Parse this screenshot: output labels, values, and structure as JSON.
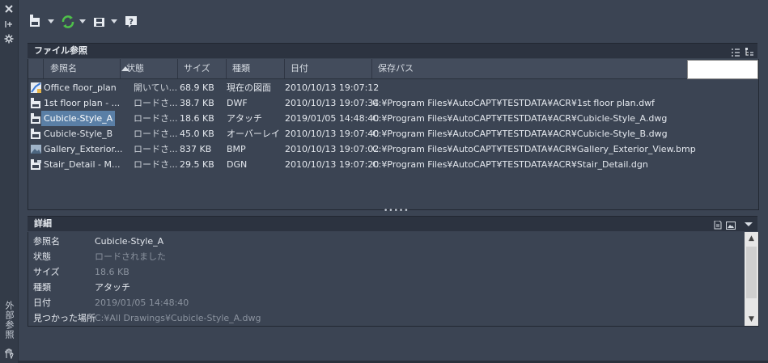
{
  "palette": {
    "window_bg": "#3b4453",
    "header_bg": "#2c3340",
    "selection": "#5a7fa6",
    "refresh_green": "#4fc04a"
  },
  "left_strip": {
    "title": "外部参照",
    "icons": [
      "close-icon",
      "pin-icon",
      "settings-icon",
      "hand-icon"
    ]
  },
  "toolbar": {
    "icons": [
      "attach-dwg-icon",
      "refresh-icon",
      "change-path-icon",
      "help-icon"
    ],
    "help_glyph": "?"
  },
  "file_refs": {
    "title": "ファイル参照",
    "columns": [
      "参照名",
      "状態",
      "サイズ",
      "種類",
      "日付",
      "保存パス"
    ],
    "rows": [
      {
        "name": "Office floor_plan",
        "status": "開いてい...",
        "size": "68.9 KB",
        "type": "現在の図面",
        "date": "2010/10/13 19:07:12",
        "path": "",
        "icon": "dwg-open-icon"
      },
      {
        "name": "1st floor plan - ...",
        "status": "ロードさ...",
        "size": "38.7 KB",
        "type": "DWF",
        "date": "2010/10/13 19:07:34",
        "path": "C:¥Program Files¥AutoCAPT¥TESTDATA¥ACR¥1st floor plan.dwf",
        "icon": "dwf-icon"
      },
      {
        "name": "Cubicle-Style_A",
        "status": "ロードさ...",
        "size": "18.6 KB",
        "type": "アタッチ",
        "date": "2019/01/05 14:48:40",
        "path": "C:¥Program Files¥AutoCAPT¥TESTDATA¥ACR¥Cubicle-Style_A.dwg",
        "icon": "dwg-icon",
        "selected": true
      },
      {
        "name": "Cubicle-Style_B",
        "status": "ロードさ...",
        "size": "45.0 KB",
        "type": "オーバーレイ",
        "date": "2010/10/13 19:07:40",
        "path": "C:¥Program Files¥AutoCAPT¥TESTDATA¥ACR¥Cubicle-Style_B.dwg",
        "icon": "dwg-icon"
      },
      {
        "name": "Gallery_Exterior...",
        "status": "ロードさ...",
        "size": "837 KB",
        "type": "BMP",
        "date": "2010/10/13 19:07:02",
        "path": "C:¥Program Files¥AutoCAPT¥TESTDATA¥ACR¥Gallery_Exterior_View.bmp",
        "icon": "image-icon"
      },
      {
        "name": "Stair_Detail - M...",
        "status": "ロードさ...",
        "size": "29.5 KB",
        "type": "DGN",
        "date": "2010/10/13 19:07:20",
        "path": "C:¥Program Files¥AutoCAPT¥TESTDATA¥ACR¥Stair_Detail.dgn",
        "icon": "dgn-icon"
      }
    ],
    "header_icons": [
      "list-view-icon",
      "tree-view-icon"
    ]
  },
  "details": {
    "title": "詳細",
    "header_icons": [
      "details-icon",
      "preview-icon",
      "chevron-down-icon"
    ],
    "rows": [
      {
        "key": "参照名",
        "value": "Cubicle-Style_A",
        "muted": false
      },
      {
        "key": "状態",
        "value": "ロードされました",
        "muted": true
      },
      {
        "key": "サイズ",
        "value": "18.6 KB",
        "muted": true
      },
      {
        "key": "種類",
        "value": "アタッチ",
        "muted": false
      },
      {
        "key": "日付",
        "value": "2019/01/05 14:48:40",
        "muted": true
      },
      {
        "key": "見つかった場所",
        "value": "C:¥All Drawings¥Cubicle-Style_A.dwg",
        "muted": true
      }
    ]
  }
}
